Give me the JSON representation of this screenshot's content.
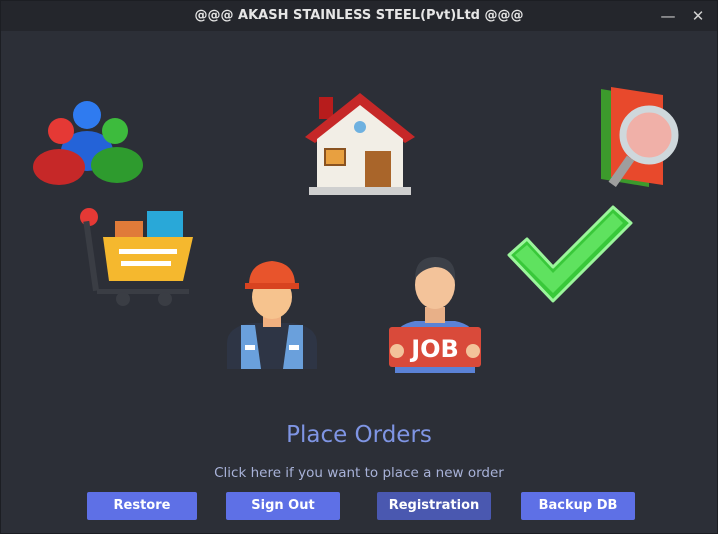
{
  "window": {
    "title": "@@@ AKASH STAINLESS STEEL(Pvt)Ltd @@@"
  },
  "icons": [
    "users-icon",
    "home-icon",
    "search-file-icon",
    "shopping-cart-icon",
    "worker-icon",
    "job-seeker-icon",
    "checkmark-icon"
  ],
  "job_sign": "JOB",
  "status": {
    "heading": "Place Orders",
    "subtext": "Click here if you want to place a new order"
  },
  "buttons": {
    "restore": "Restore",
    "sign_out": "Sign Out",
    "registration": "Registration",
    "backup_db": "Backup DB"
  },
  "colors": {
    "accent": "#5e70e6",
    "heading": "#7f95e4",
    "background": "#2c2f37"
  }
}
